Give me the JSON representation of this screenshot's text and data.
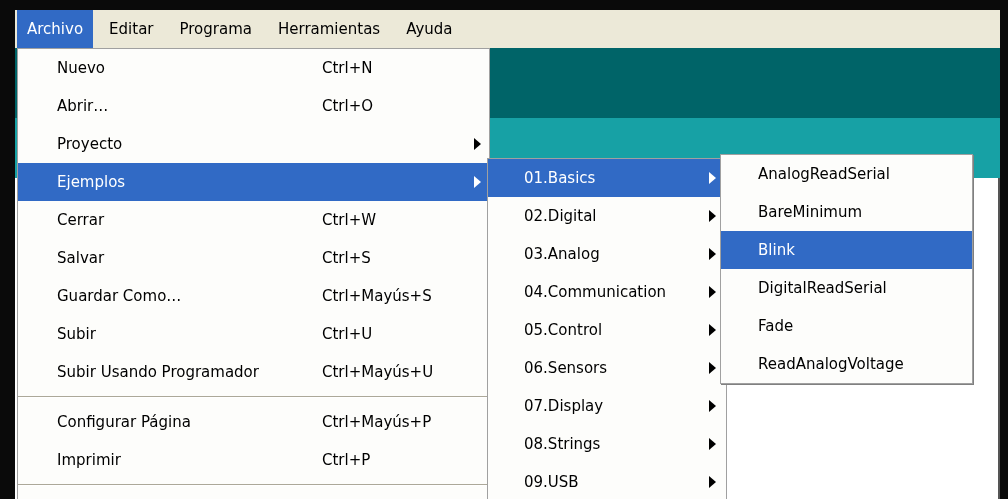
{
  "menubar": [
    {
      "label": "Archivo",
      "selected": true
    },
    {
      "label": "Editar",
      "selected": false
    },
    {
      "label": "Programa",
      "selected": false
    },
    {
      "label": "Herramientas",
      "selected": false
    },
    {
      "label": "Ayuda",
      "selected": false
    }
  ],
  "file_menu": [
    {
      "kind": "item",
      "label": "Nuevo",
      "shortcut": "Ctrl+N",
      "submenu": false,
      "selected": false
    },
    {
      "kind": "item",
      "label": "Abrir…",
      "shortcut": "Ctrl+O",
      "submenu": false,
      "selected": false
    },
    {
      "kind": "item",
      "label": "Proyecto",
      "submenu": true,
      "selected": false
    },
    {
      "kind": "item",
      "label": "Ejemplos",
      "submenu": true,
      "selected": true
    },
    {
      "kind": "item",
      "label": "Cerrar",
      "shortcut": "Ctrl+W",
      "submenu": false,
      "selected": false
    },
    {
      "kind": "item",
      "label": "Salvar",
      "shortcut": "Ctrl+S",
      "submenu": false,
      "selected": false
    },
    {
      "kind": "item",
      "label": "Guardar Como…",
      "shortcut": "Ctrl+Mayús+S",
      "submenu": false,
      "selected": false
    },
    {
      "kind": "item",
      "label": "Subir",
      "shortcut": "Ctrl+U",
      "submenu": false,
      "selected": false
    },
    {
      "kind": "item",
      "label": "Subir Usando Programador",
      "shortcut": "Ctrl+Mayús+U",
      "submenu": false,
      "selected": false
    },
    {
      "kind": "separator"
    },
    {
      "kind": "item",
      "label": "Configurar Página",
      "shortcut": "Ctrl+Mayús+P",
      "submenu": false,
      "selected": false
    },
    {
      "kind": "item",
      "label": "Imprimir",
      "shortcut": "Ctrl+P",
      "submenu": false,
      "selected": false
    },
    {
      "kind": "separator"
    }
  ],
  "examples_menu": [
    {
      "label": "01.Basics",
      "submenu": true,
      "selected": true
    },
    {
      "label": "02.Digital",
      "submenu": true,
      "selected": false
    },
    {
      "label": "03.Analog",
      "submenu": true,
      "selected": false
    },
    {
      "label": "04.Communication",
      "submenu": true,
      "selected": false
    },
    {
      "label": "05.Control",
      "submenu": true,
      "selected": false
    },
    {
      "label": "06.Sensors",
      "submenu": true,
      "selected": false
    },
    {
      "label": "07.Display",
      "submenu": true,
      "selected": false
    },
    {
      "label": "08.Strings",
      "submenu": true,
      "selected": false
    },
    {
      "label": "09.USB",
      "submenu": true,
      "selected": false
    }
  ],
  "basics_menu": [
    {
      "label": "AnalogReadSerial",
      "selected": false
    },
    {
      "label": "BareMinimum",
      "selected": false
    },
    {
      "label": "Blink",
      "selected": true
    },
    {
      "label": "DigitalReadSerial",
      "selected": false
    },
    {
      "label": "Fade",
      "selected": false
    },
    {
      "label": "ReadAnalogVoltage",
      "selected": false
    }
  ]
}
